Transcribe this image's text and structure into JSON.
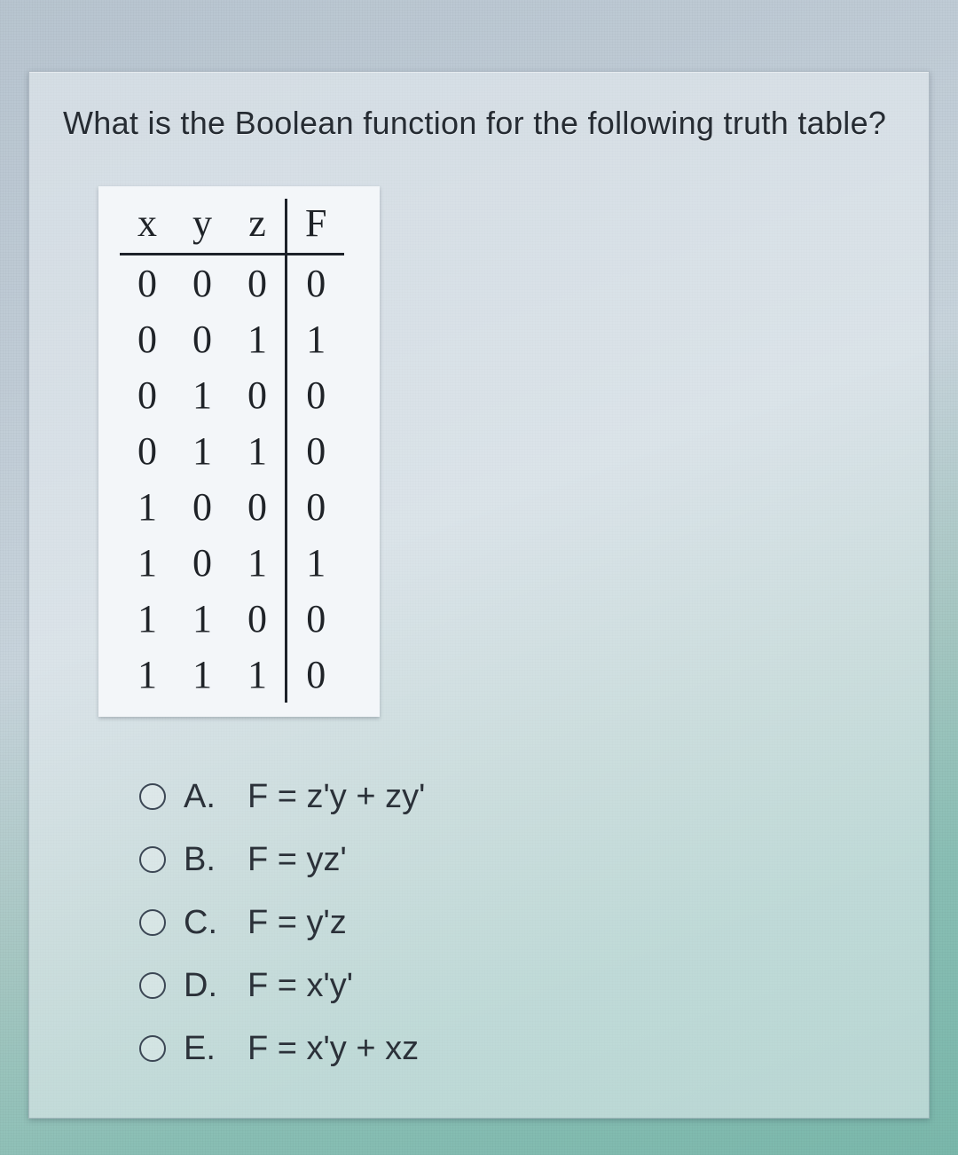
{
  "question": "What is the Boolean function for the following truth table?",
  "table": {
    "headers": [
      "x",
      "y",
      "z",
      "F"
    ],
    "rows": [
      [
        "0",
        "0",
        "0",
        "0"
      ],
      [
        "0",
        "0",
        "1",
        "1"
      ],
      [
        "0",
        "1",
        "0",
        "0"
      ],
      [
        "0",
        "1",
        "1",
        "0"
      ],
      [
        "1",
        "0",
        "0",
        "0"
      ],
      [
        "1",
        "0",
        "1",
        "1"
      ],
      [
        "1",
        "1",
        "0",
        "0"
      ],
      [
        "1",
        "1",
        "1",
        "0"
      ]
    ]
  },
  "options": [
    {
      "letter": "A.",
      "expr": "F = z'y + zy'"
    },
    {
      "letter": "B.",
      "expr": "F = yz'"
    },
    {
      "letter": "C.",
      "expr": "F = y'z"
    },
    {
      "letter": "D.",
      "expr": "F = x'y'"
    },
    {
      "letter": "E.",
      "expr": "F = x'y + xz"
    }
  ]
}
